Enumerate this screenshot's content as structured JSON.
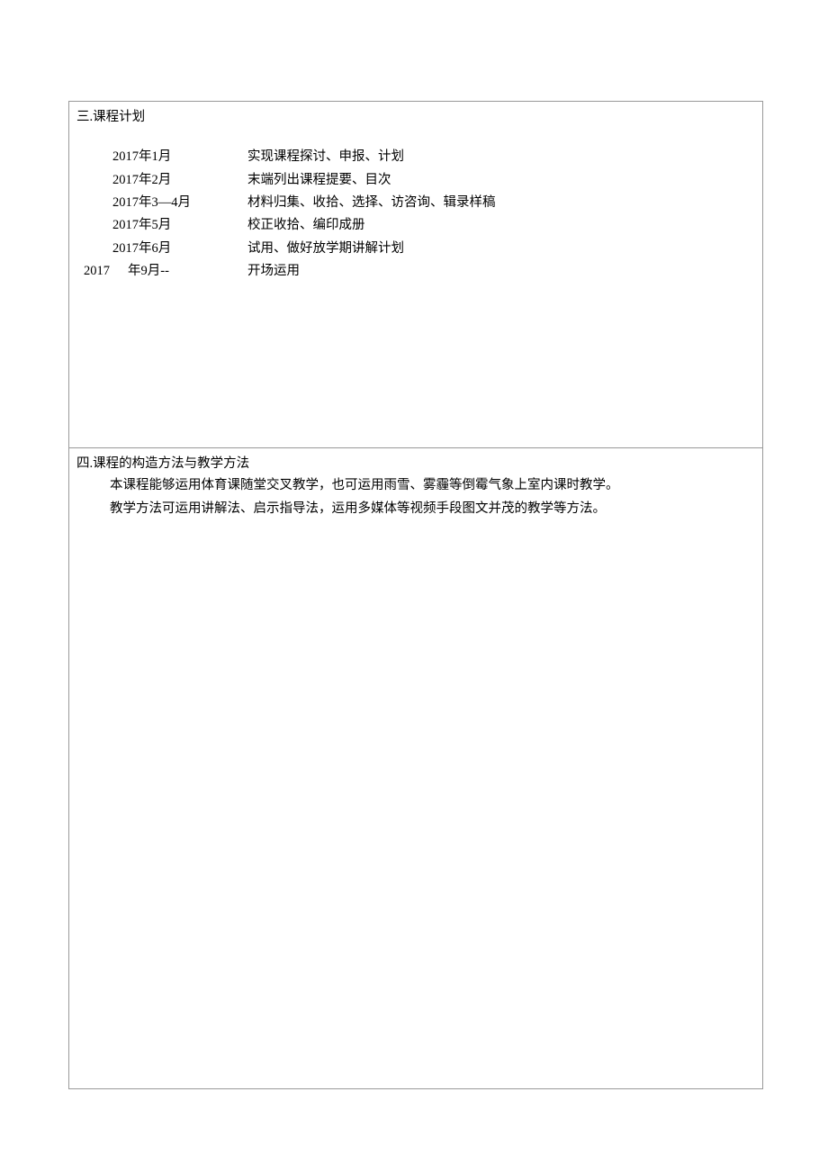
{
  "section3": {
    "title": "三.课程计划",
    "schedule": [
      {
        "date": "2017年1月",
        "desc": "实现课程探讨、申报、计划"
      },
      {
        "date": "2017年2月",
        "desc": "末端列出课程提要、目次"
      },
      {
        "date": "2017年3—4月",
        "desc": "材料归集、收拾、选择、访咨询、辑录样稿"
      },
      {
        "date": "2017年5月",
        "desc": "校正收拾、编印成册"
      },
      {
        "date": "2017年6月",
        "desc": "试用、做好放学期讲解计划"
      }
    ],
    "lastRow": {
      "year": "2017",
      "month": "年9月--",
      "desc": "开场运用"
    }
  },
  "section4": {
    "title": "四.课程的构造方法与教学方法",
    "para1": "本课程能够运用体育课随堂交叉教学，也可运用雨雪、雾霾等倒霉气象上室内课时教学。",
    "para2": "教学方法可运用讲解法、启示指导法，运用多媒体等视频手段图文并茂的教学等方法。"
  }
}
